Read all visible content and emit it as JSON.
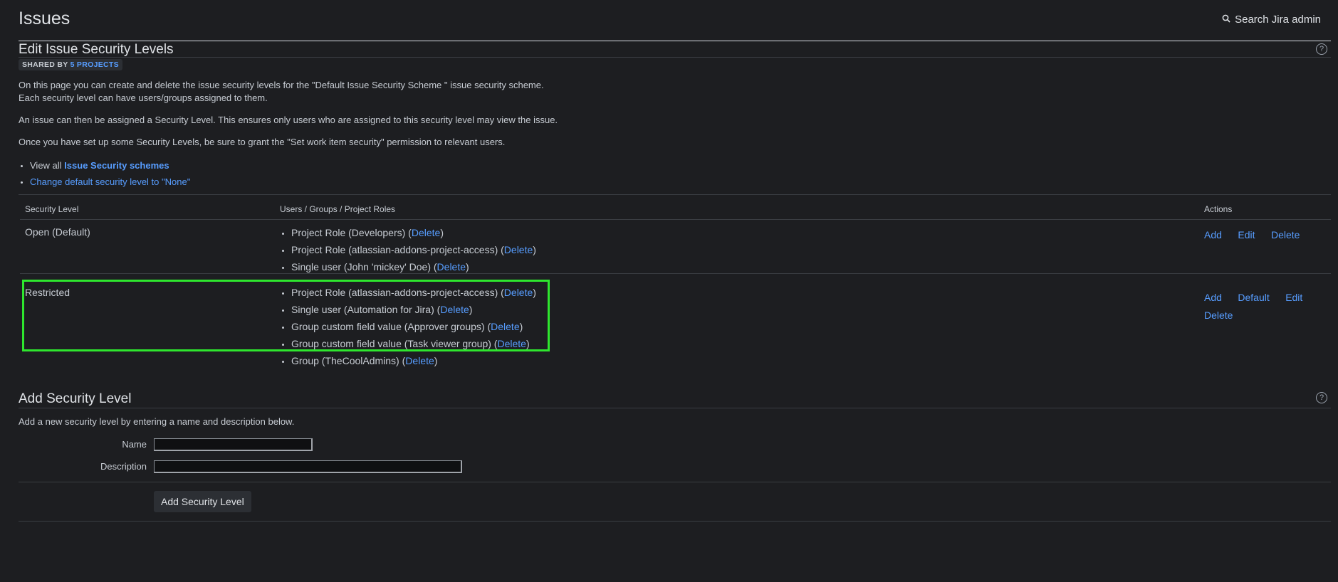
{
  "header": {
    "title": "Issues",
    "search_label": "Search Jira admin"
  },
  "edit_section": {
    "title": "Edit Issue Security Levels",
    "shared_prefix": "SHARED BY",
    "shared_link": "5 PROJECTS",
    "para1_line1": "On this page you can create and delete the issue security levels for the \"Default Issue Security Scheme \" issue security scheme.",
    "para1_line2": "Each security level can have users/groups assigned to them.",
    "para2": "An issue can then be assigned a Security Level. This ensures only users who are assigned to this security level may view the issue.",
    "para3": "Once you have set up some Security Levels, be sure to grant the \"Set work item security\" permission to relevant users.",
    "view_all_prefix": "View all",
    "view_all_link": "Issue Security schemes",
    "change_default_link": "Change default security level to \"None\""
  },
  "table": {
    "headers": [
      "Security Level",
      "Users / Groups / Project Roles",
      "Actions"
    ],
    "rows": [
      {
        "level": "Open (Default)",
        "members": [
          {
            "text": "Project Role (Developers)",
            "action": "Delete"
          },
          {
            "text": "Project Role (atlassian-addons-project-access)",
            "action": "Delete"
          },
          {
            "text": "Single user (John 'mickey' Doe)",
            "action": "Delete"
          }
        ],
        "actions": [
          "Add",
          "Edit",
          "Delete"
        ]
      },
      {
        "level": "Restricted",
        "members": [
          {
            "text": "Project Role (atlassian-addons-project-access)",
            "action": "Delete"
          },
          {
            "text": "Single user (Automation for Jira)",
            "action": "Delete"
          },
          {
            "text": "Group custom field value (Approver groups)",
            "action": "Delete"
          },
          {
            "text": "Group custom field value (Task viewer group)",
            "action": "Delete"
          },
          {
            "text": "Group (TheCoolAdmins)",
            "action": "Delete"
          }
        ],
        "actions": [
          "Add",
          "Default",
          "Edit",
          "Delete"
        ]
      }
    ]
  },
  "add_section": {
    "title": "Add Security Level",
    "description": "Add a new security level by entering a name and description below.",
    "name_label": "Name",
    "name_value": "",
    "description_label": "Description",
    "description_value": "",
    "submit_label": "Add Security Level"
  },
  "colors": {
    "background": "#1d1e21",
    "link": "#579dff",
    "highlight": "#2ee62e"
  }
}
